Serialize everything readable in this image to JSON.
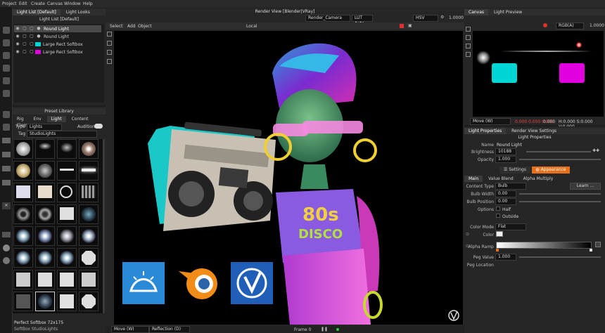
{
  "menu": [
    "Project",
    "Edit",
    "Create",
    "Canvas",
    "Window",
    "Help"
  ],
  "light_list": {
    "tabs": [
      "Light List [Default]",
      "Light Looks"
    ],
    "title": "Light List [Default]",
    "items": [
      {
        "label": "Round Light",
        "color": "#f0f0f0",
        "selected": true
      },
      {
        "label": "Round Light",
        "color": "#f0f0f0",
        "selected": false
      },
      {
        "label": "Large Rect Softbox",
        "color": "#00d4d4",
        "selected": false
      },
      {
        "label": "Large Rect Softbox",
        "color": "#e000e0",
        "selected": false
      }
    ]
  },
  "preset_library": {
    "title": "Preset Library",
    "tabs": [
      "Rig",
      "Env",
      "Light",
      "Content",
      "Elem"
    ],
    "type_label": "Type",
    "type_value": "Lights",
    "audition_label": "Audition",
    "tag_label": "Tag",
    "tag_value": "StudioLights",
    "selected_name": "Perfect Softbox 72x175",
    "footer_tag": "SoftBox StudioLights"
  },
  "render_view": {
    "title": "Render View [Blender|VRay]",
    "camera": "Render_Camera",
    "lut": "LUT Auto",
    "color_space": "HSV",
    "exposure": "1.0000",
    "menu": [
      "Select",
      "Add",
      "Object"
    ],
    "transform": "Local",
    "move_mode": "Move (W)",
    "reflection_mode": "Reflection (D)",
    "frame": "Frame 0"
  },
  "canvas": {
    "tabs": [
      "Canvas",
      "Light Preview"
    ],
    "channel": "RGB(A)",
    "exposure": "1.0000",
    "move_mode": "Move (W)",
    "rgb": "0.000 0.000 0.000",
    "alpha": "0.000",
    "hsv": "H:0.000 S:0.000 V:0.000"
  },
  "properties": {
    "tabs": [
      "Light Properties",
      "Render View Settings"
    ],
    "title": "Light Properties",
    "name_label": "Name",
    "name_value": "Round Light",
    "brightness_label": "Brightness",
    "brightness_value": "10188",
    "opacity_label": "Opacity",
    "opacity_value": "1.000",
    "sub_tabs": [
      "Settings",
      "Appearance"
    ],
    "section_tabs": [
      "Main",
      "Value Blend",
      "Alpha Multiply"
    ],
    "content_type_label": "Content Type",
    "content_type_value": "Bulb",
    "learn_label": "Learn ...",
    "bulb_width_label": "Bulb Width",
    "bulb_width_value": "0.00",
    "bulb_position_label": "Bulb Position",
    "bulb_position_value": "0.00",
    "options_label": "Options",
    "half_label": "Half",
    "outside_label": "Outside",
    "color_mode_label": "Color Mode",
    "color_mode_value": "Flat",
    "color_label": "Color",
    "alpha_ramp_label": "Alpha Ramp",
    "peg_value_label": "Peg Value",
    "peg_value_value": "1.000",
    "peg_location_label": "Peg Location"
  },
  "colors": {
    "cyan": "#00d4d4",
    "magenta": "#e000e0",
    "accent": "#e8701a"
  }
}
